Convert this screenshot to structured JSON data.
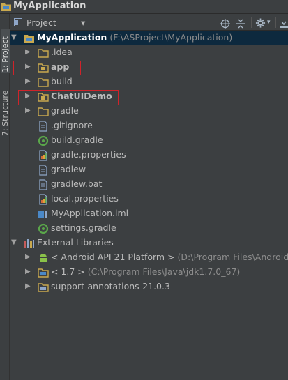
{
  "window": {
    "title": "MyApplication"
  },
  "sidebar": {
    "tabs": [
      {
        "label": "1: Project"
      },
      {
        "label": "7: Structure"
      }
    ]
  },
  "toolbar": {
    "view_select": "Project"
  },
  "tree": {
    "root": {
      "name": "MyApplication",
      "path": "(F:\\ASProject\\MyApplication)"
    },
    "items": [
      {
        "label": ".idea"
      },
      {
        "label": "app"
      },
      {
        "label": "build"
      },
      {
        "label": "ChatUIDemo"
      },
      {
        "label": "gradle"
      },
      {
        "label": ".gitignore"
      },
      {
        "label": "build.gradle"
      },
      {
        "label": "gradle.properties"
      },
      {
        "label": "gradlew"
      },
      {
        "label": "gradlew.bat"
      },
      {
        "label": "local.properties"
      },
      {
        "label": "MyApplication.iml"
      },
      {
        "label": "settings.gradle"
      }
    ],
    "external": {
      "label": "External Libraries",
      "items": [
        {
          "label": "< Android API 21 Platform >",
          "path": "(D:\\Program Files\\Android so"
        },
        {
          "label": "< 1.7 >",
          "path": "(C:\\Program Files\\Java\\jdk1.7.0_67)"
        },
        {
          "label": "support-annotations-21.0.3"
        }
      ]
    }
  },
  "colors": {
    "highlight_box": "#d0232a",
    "selection": "#0d293e",
    "background": "#3c3f41"
  }
}
